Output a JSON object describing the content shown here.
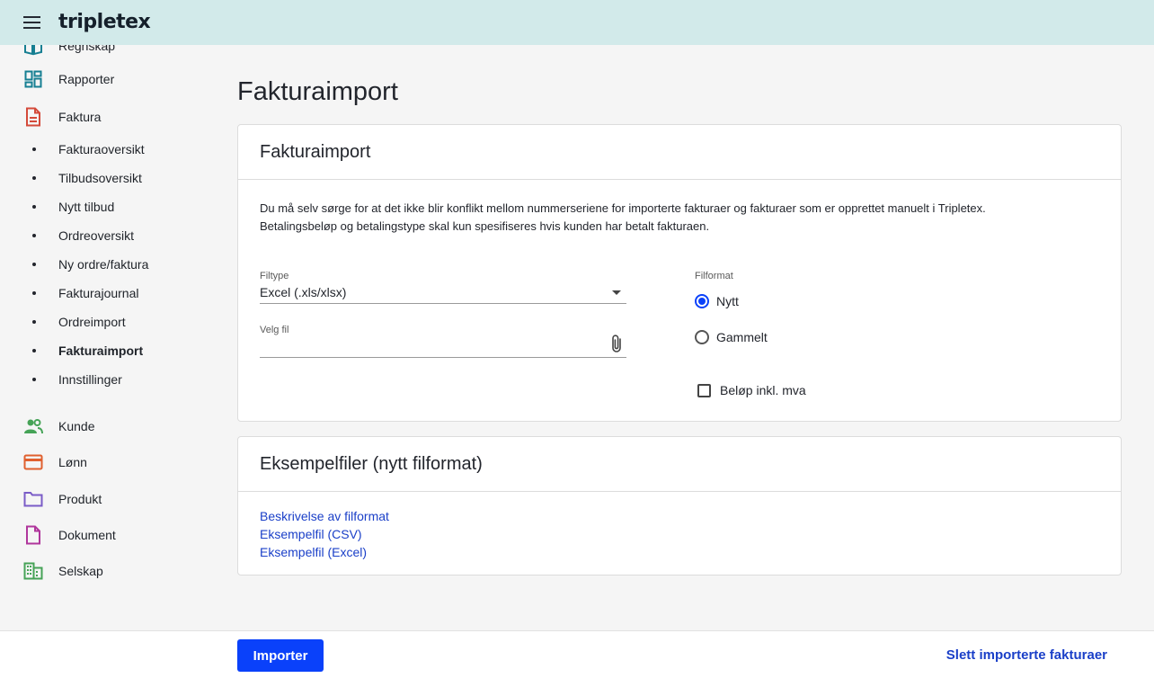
{
  "topbar": {
    "logo": "tripletex"
  },
  "sidebar": {
    "partial_item": "Regnskap",
    "items_top": [
      {
        "label": "Rapporter",
        "icon": "dashboard-icon"
      },
      {
        "label": "Faktura",
        "icon": "document-icon"
      }
    ],
    "sub_items": [
      {
        "label": "Fakturaoversikt"
      },
      {
        "label": "Tilbudsoversikt"
      },
      {
        "label": "Nytt tilbud"
      },
      {
        "label": "Ordreoversikt"
      },
      {
        "label": "Ny ordre/faktura"
      },
      {
        "label": "Fakturajournal"
      },
      {
        "label": "Ordreimport"
      },
      {
        "label": "Fakturaimport",
        "active": true
      },
      {
        "label": "Innstillinger"
      }
    ],
    "items_bottom": [
      {
        "label": "Kunde",
        "icon": "people-icon"
      },
      {
        "label": "Lønn",
        "icon": "card-icon"
      },
      {
        "label": "Produkt",
        "icon": "folder-icon"
      },
      {
        "label": "Dokument",
        "icon": "file-icon"
      },
      {
        "label": "Selskap",
        "icon": "building-icon"
      }
    ],
    "colors": {
      "teal": "#167f92",
      "red": "#d44a3a",
      "green": "#46a357",
      "orange": "#e0602e",
      "purple": "#7a5cc7",
      "magenta": "#b0369c"
    }
  },
  "main": {
    "page_title": "Fakturaimport",
    "card1": {
      "title": "Fakturaimport",
      "desc_line1": "Du må selv sørge for at det ikke blir konflikt mellom nummerseriene for importerte fakturaer og fakturaer som er opprettet manuelt i Tripletex.",
      "desc_line2": "Betalingsbeløp og betalingstype skal kun spesifiseres hvis kunden har betalt fakturaen.",
      "filetype_label": "Filtype",
      "filetype_value": "Excel (.xls/xlsx)",
      "file_label": "Velg fil",
      "format_label": "Filformat",
      "format_options": [
        "Nytt",
        "Gammelt"
      ],
      "format_selected": "Nytt",
      "checkbox_label": "Beløp inkl. mva"
    },
    "card2": {
      "title": "Eksempelfiler (nytt filformat)",
      "links": [
        "Beskrivelse av filformat",
        "Eksempelfil (CSV)",
        "Eksempelfil (Excel)"
      ]
    }
  },
  "footer": {
    "import_button": "Importer",
    "delete_link": "Slett importerte fakturaer",
    "accent": "#0a41fa"
  }
}
